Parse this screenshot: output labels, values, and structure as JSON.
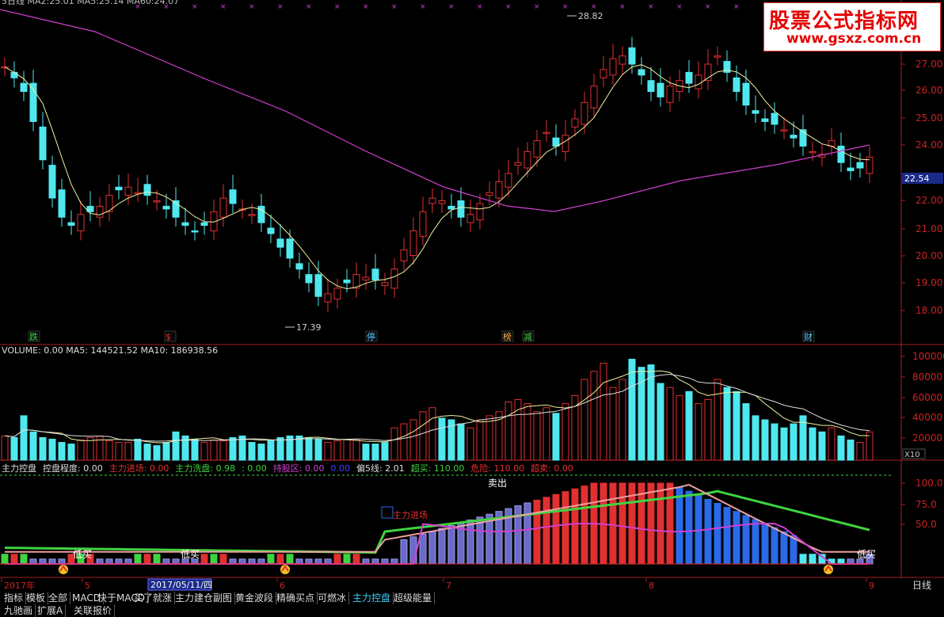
{
  "watermark": {
    "title": "股票公式指标网",
    "url": "www.gsxz.com.cn"
  },
  "main_header": {
    "text": "5日线 MA2:25.01 MA5:25.14 MA60:24.07"
  },
  "main_chart": {
    "type": "candlestick",
    "yticks": [
      "27.00",
      "26.00",
      "25.00",
      "24.00",
      "22.00",
      "21.00",
      "20.00",
      "19.00",
      "18.00"
    ],
    "current_price": "22.54",
    "high_label": "28.82",
    "low_label": "17.39",
    "event_markers": [
      {
        "label": "跌",
        "color": "#3fd43f"
      },
      {
        "label": "$",
        "color": "#e03030"
      },
      {
        "label": "停",
        "color": "#4fc8ff"
      },
      {
        "label": "榜",
        "color": "#ffb040"
      },
      {
        "label": "减",
        "color": "#3fd43f"
      },
      {
        "label": "财",
        "color": "#4fc8ff"
      }
    ]
  },
  "volume_panel": {
    "prefix": "VOLUME: 0.00",
    "ma5": "MA5: 144521.52",
    "ma10": "MA10: 186938.56",
    "yticks": [
      "100000",
      "80000",
      "60000",
      "40000",
      "20000"
    ],
    "unit": "X10"
  },
  "indicator_panel": {
    "items": [
      {
        "text": "主力控盘",
        "color": "#dddddd"
      },
      {
        "text": "控盘程度: 0.00",
        "color": "#dddddd"
      },
      {
        "text": "主力进场: 0.00",
        "color": "#e83030"
      },
      {
        "text": "主力洗盘: 0.98",
        "color": "#3fd43f"
      },
      {
        "text": ": 0.00",
        "color": "#3fd43f"
      },
      {
        "text": "持股区: 0.00",
        "color": "#d040d0"
      },
      {
        "text": "0.00",
        "color": "#4040ff"
      },
      {
        "text": "偏5线: 2.01",
        "color": "#dddddd"
      },
      {
        "text": "超买: 110.00",
        "color": "#3fd43f"
      },
      {
        "text": "危险: 110.00",
        "color": "#e83030"
      },
      {
        "text": "超卖: 0.00",
        "color": "#e83030"
      }
    ],
    "yticks": [
      "100.0",
      "75.0",
      "50.0"
    ],
    "sell_label": "卖出",
    "buy_labels": [
      "低买",
      "低买",
      "低买"
    ],
    "mid_label": "主力进场"
  },
  "axis": {
    "date_labels": [
      "2017年",
      "5",
      "6",
      "7",
      "8",
      "9"
    ],
    "cursor_date": "2017/05/11/四",
    "period": "日线"
  },
  "tabs": [
    "指标",
    "模板",
    "全部",
    "MACD",
    "快于MACD",
    "买了就涨",
    "主力建仓副图",
    "黄金波段",
    "精确买点",
    "可燃冰",
    "主力控盘",
    "超级能量"
  ],
  "active_tab": "主力控盘",
  "bottom_tabs": [
    "九驰画",
    "扩展A",
    "关联报价"
  ]
}
